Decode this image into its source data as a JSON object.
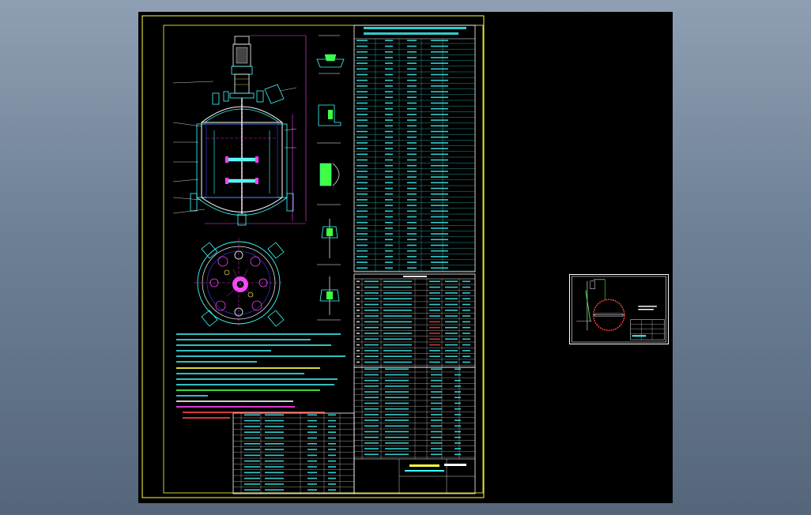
{
  "viewer": {
    "background_colors": [
      "#8f9fb3",
      "#55667b"
    ],
    "paper_color": "#000000"
  },
  "drawing": {
    "frame_color": "#ffff40",
    "line_colors": {
      "cyan": "#40ffff",
      "magenta": "#ff40ff",
      "yellow": "#ffff40",
      "white": "#ffffff",
      "green": "#40ff40",
      "red": "#ff4040",
      "blue": "#4040ff"
    },
    "views": [
      "front-section-view",
      "top-view",
      "detail-views",
      "technical-table",
      "parts-list",
      "title-block"
    ],
    "thumbnail": {
      "background": "#000000",
      "frame_color": "#ffffff"
    }
  }
}
